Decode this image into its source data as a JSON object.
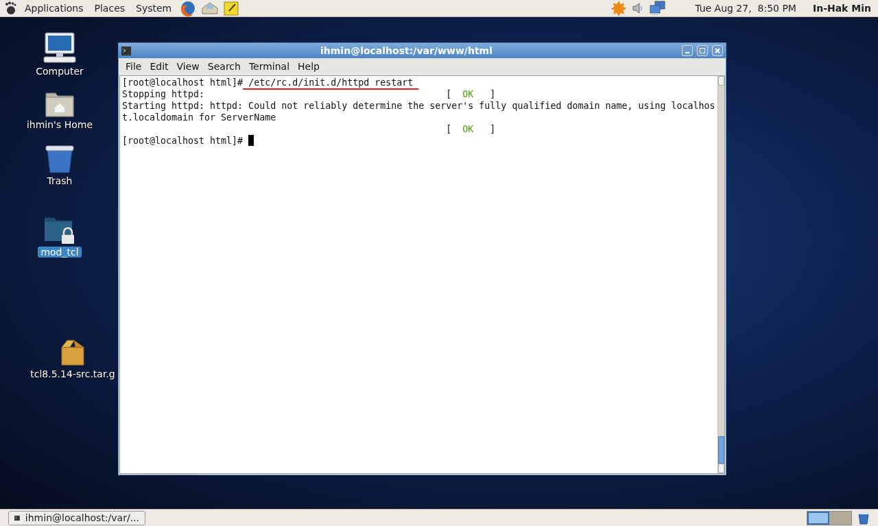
{
  "top_panel": {
    "menus": [
      {
        "label": "Applications"
      },
      {
        "label": "Places"
      },
      {
        "label": "System"
      }
    ],
    "clock": "Tue Aug 27,  8:50 PM",
    "user": "In-Hak Min"
  },
  "desktop_icons": [
    {
      "kind": "computer",
      "label": "Computer",
      "selected": false
    },
    {
      "kind": "home",
      "label": "ihmin's Home",
      "selected": false
    },
    {
      "kind": "trash",
      "label": "Trash",
      "selected": false
    },
    {
      "kind": "locked-folder",
      "label": "mod_tcl",
      "selected": true
    },
    {
      "kind": "package",
      "label": "tcl8.5.14-src.tar.g",
      "selected": false
    }
  ],
  "window": {
    "title": "ihmin@localhost:/var/www/html",
    "menu": [
      {
        "label": "File"
      },
      {
        "label": "Edit"
      },
      {
        "label": "View"
      },
      {
        "label": "Search"
      },
      {
        "label": "Terminal"
      },
      {
        "label": "Help"
      }
    ],
    "lines": [
      {
        "kind": "prompt",
        "prompt": "[root@localhost html]#",
        "command": " /etc/rc.d/init.d/httpd restart ",
        "underlined": true
      },
      {
        "kind": "status",
        "text": "Stopping httpd:",
        "open": "[",
        "ok": "OK",
        "close": "]"
      },
      {
        "kind": "text",
        "text": "Starting httpd: httpd: Could not reliably determine the server's fully qualified domain name, using localhos"
      },
      {
        "kind": "text",
        "text": "t.localdomain for ServerName"
      },
      {
        "kind": "status",
        "open": "[",
        "ok": "OK",
        "close": "]"
      },
      {
        "kind": "prompt",
        "prompt": "[root@localhost html]#",
        "cursor": true
      }
    ]
  },
  "taskbar": {
    "items": [
      {
        "label": "ihmin@localhost:/var/...",
        "selected": false
      }
    ],
    "workspaces": [
      {
        "selected": true
      },
      {
        "selected": false
      }
    ]
  }
}
